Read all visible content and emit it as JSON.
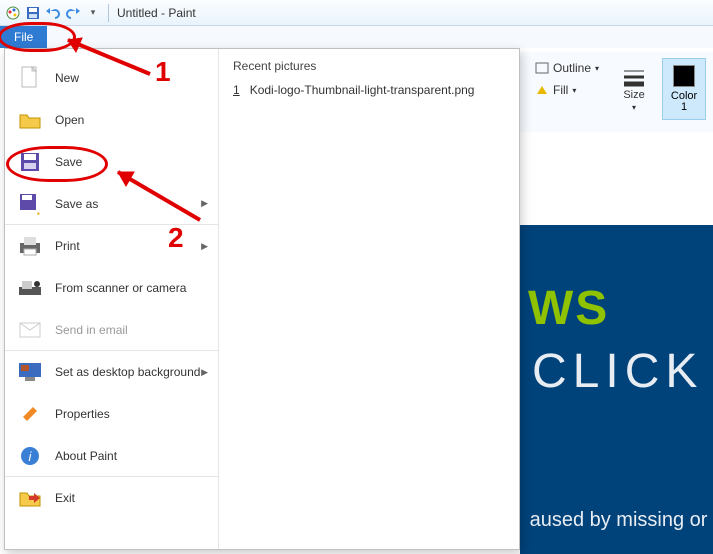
{
  "titlebar": {
    "title": "Untitled - Paint"
  },
  "filetab": {
    "label": "File"
  },
  "menu": {
    "items": [
      {
        "label": "New"
      },
      {
        "label": "Open"
      },
      {
        "label": "Save"
      },
      {
        "label": "Save as",
        "arrow": true,
        "sep": true
      },
      {
        "label": "Print",
        "arrow": true
      },
      {
        "label": "From scanner or camera"
      },
      {
        "label": "Send in email",
        "disabled": true,
        "sep": true
      },
      {
        "label": "Set as desktop background",
        "arrow": true
      },
      {
        "label": "Properties"
      },
      {
        "label": "About Paint",
        "sep": true
      },
      {
        "label": "Exit"
      }
    ],
    "recent": {
      "title": "Recent pictures",
      "items": [
        {
          "num": "1",
          "name": "Kodi-logo-Thumbnail-light-transparent.png"
        }
      ]
    }
  },
  "ribbon": {
    "outline": "Outline",
    "fill": "Fill",
    "size": "Size",
    "color1": "Color\n1"
  },
  "banner": {
    "ws": "WS",
    "click": "CLICK",
    "missing": "aused by missing or c"
  },
  "anno": {
    "n1": "1",
    "n2": "2"
  }
}
